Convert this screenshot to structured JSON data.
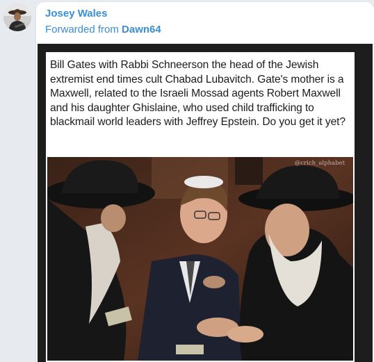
{
  "message": {
    "sender_name": "Josey Wales",
    "forwarded_prefix": "Forwarded from ",
    "forwarded_source": "Dawn64"
  },
  "media": {
    "caption": "Bill Gates with Rabbi Schneerson the head of the Jewish extremist end times cult Chabad Lubavitch. Gate's mother is a Maxwell, related to the Israeli Mossad agents Robert Maxwell and his daughter Ghislaine, who used child trafficking to blackmail world leaders with Jeffrey Epstein. Do you get it yet?",
    "watermark": "@crich_alphabet"
  },
  "colors": {
    "link_blue": "#3a8ed4",
    "chat_background": "#e7ebf0",
    "media_background": "#1d1d1d"
  },
  "icons": {
    "avatar": "user-avatar-icon"
  }
}
